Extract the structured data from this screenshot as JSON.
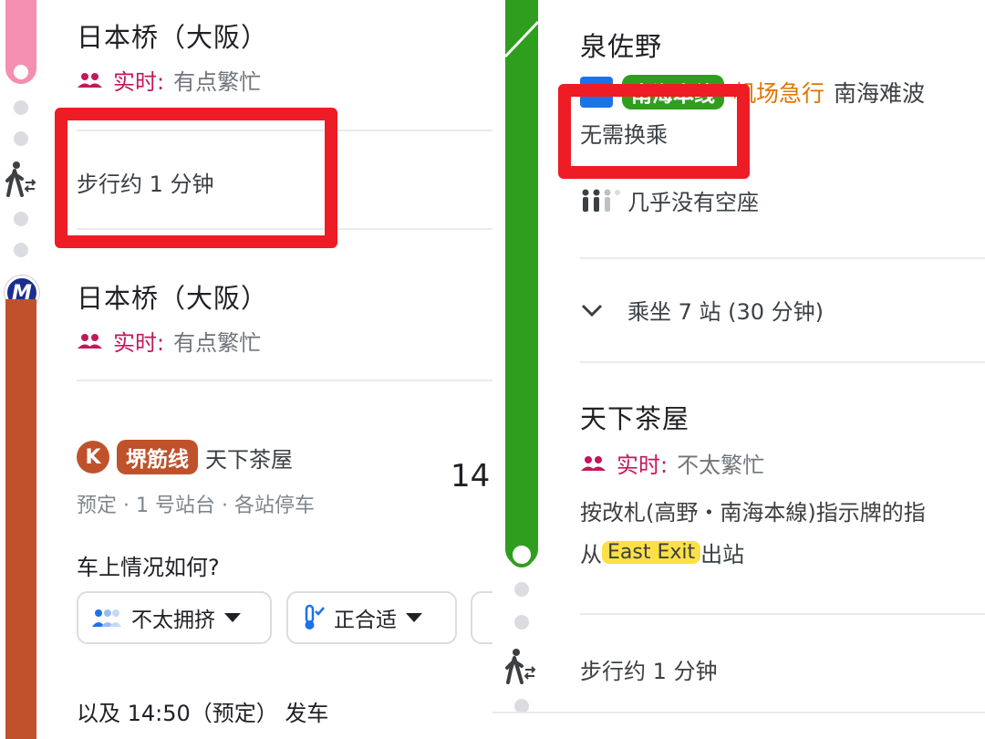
{
  "left": {
    "stop1": {
      "name": "日本桥（大阪）",
      "realtime_label": "实时:",
      "realtime_value": "有点繁忙"
    },
    "walk": {
      "text": "步行约 1 分钟"
    },
    "stop2": {
      "name": "日本桥（大阪）",
      "realtime_label": "实时:",
      "realtime_value": "有点繁忙"
    },
    "metro_icon_label": "M",
    "line": {
      "circle_letter": "K",
      "name": "堺筋线",
      "direction": "天下茶屋",
      "details": "预定 · 1 号站台 · 各站停车",
      "time": "14"
    },
    "feedback": {
      "question": "车上情况如何?",
      "crowd_option": "不太拥挤",
      "temp_option": "正合适"
    },
    "next": "以及 14:50（预定） 发车",
    "colors": {
      "pink_line": "#f48fb1",
      "orange_line": "#c0522b",
      "realtime": "#c2185b",
      "metro_badge": "#1c2d8f"
    }
  },
  "right": {
    "stop1": {
      "name": "泉佐野"
    },
    "line": {
      "name": "南海本线",
      "service": "机场急行",
      "direction": "南海难波"
    },
    "transfer": "无需换乘",
    "seats": "几乎没有空座",
    "ride": "乘坐 7 站 (30 分钟)",
    "stop2": {
      "name": "天下茶屋",
      "realtime_label": "实时:",
      "realtime_value": "不太繁忙",
      "instruction": "按改札(高野・南海本線)指示牌的指",
      "exit_prefix": "从",
      "exit_label": "East Exit",
      "exit_suffix": "出站"
    },
    "walk": {
      "text": "步行约 1 分钟"
    },
    "colors": {
      "green_line": "#2f9e1f",
      "service": "#e37400",
      "exit_highlight": "#fde047"
    }
  }
}
